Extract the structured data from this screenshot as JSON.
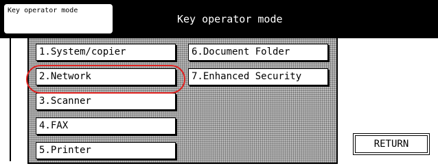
{
  "header": {
    "mode_tab_label": "Key operator mode",
    "title": "Key operator mode"
  },
  "menu": {
    "items": [
      {
        "label": "1.System/copier"
      },
      {
        "label": "2.Network"
      },
      {
        "label": "3.Scanner"
      },
      {
        "label": "4.FAX"
      },
      {
        "label": "5.Printer"
      },
      {
        "label": "6.Document Folder"
      },
      {
        "label": "7.Enhanced Security"
      }
    ],
    "highlighted_item": "2.Network"
  },
  "footer": {
    "return_label": "RETURN"
  },
  "colors": {
    "header_bg": "#000000",
    "panel_bg": "#b9b9b9",
    "highlight_ring": "#e0201e"
  }
}
